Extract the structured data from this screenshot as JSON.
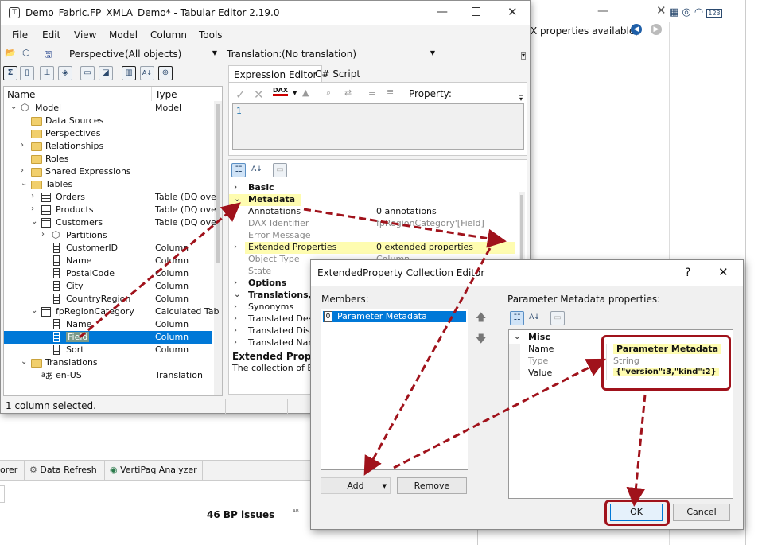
{
  "bg_window": {
    "partial_text": "X properties available)",
    "status_issues": "46 BP issues",
    "bottom_tabs": [
      "orer",
      "Data Refresh",
      "VertiPaq Analyzer"
    ]
  },
  "main": {
    "title": "Demo_Fabric.FP_XMLA_Demo* - Tabular Editor 2.19.0",
    "menu": [
      "File",
      "Edit",
      "View",
      "Model",
      "Column",
      "Tools"
    ],
    "perspective_label": "Perspective:",
    "perspective_value": "(All objects)",
    "translation_label": "Translation:",
    "translation_value": "(No translation)",
    "tree_headers": {
      "name": "Name",
      "type": "Type"
    },
    "tree": [
      {
        "label": "Model",
        "type": "Model"
      },
      {
        "label": "Data Sources",
        "type": ""
      },
      {
        "label": "Perspectives",
        "type": ""
      },
      {
        "label": "Relationships",
        "type": ""
      },
      {
        "label": "Roles",
        "type": ""
      },
      {
        "label": "Shared Expressions",
        "type": ""
      },
      {
        "label": "Tables",
        "type": ""
      },
      {
        "label": "Orders",
        "type": "Table (DQ ove"
      },
      {
        "label": "Products",
        "type": "Table (DQ ove"
      },
      {
        "label": "Customers",
        "type": "Table (DQ ove"
      },
      {
        "label": "Partitions",
        "type": ""
      },
      {
        "label": "CustomerID",
        "type": "Column"
      },
      {
        "label": "Name",
        "type": "Column"
      },
      {
        "label": "PostalCode",
        "type": "Column"
      },
      {
        "label": "City",
        "type": "Column"
      },
      {
        "label": "CountryRegion",
        "type": "Column"
      },
      {
        "label": "fpRegionCategory",
        "type": "Calculated Tab"
      },
      {
        "label": "Name",
        "type": "Column"
      },
      {
        "label": "Field",
        "type": "Column"
      },
      {
        "label": "Sort",
        "type": "Column"
      },
      {
        "label": "Translations",
        "type": ""
      },
      {
        "label": "en-US",
        "type": "Translation"
      }
    ],
    "status": "1 column selected.",
    "editor_tabs": [
      "Expression Editor",
      "C# Script"
    ],
    "property_label": "Property:",
    "line_number": "1",
    "props": {
      "basic": "Basic",
      "metadata": "Metadata",
      "annotations_k": "Annotations",
      "annotations_v": "0 annotations",
      "dax_k": "DAX Identifier",
      "dax_v": "fpRegionCategory'[Field]",
      "error_k": "Error Message",
      "ext_k": "Extended Properties",
      "ext_v": "0 extended properties",
      "objtype_k": "Object Type",
      "objtype_v": "Column",
      "state_k": "State",
      "options": "Options",
      "translations": "Translations,",
      "synonyms": "Synonyms",
      "trans_desc": "Translated Desc",
      "trans_disp": "Translated Disp",
      "trans_name": "Translated Nam",
      "desc_title": "Extended Proper",
      "desc_text": "The collection of Ex"
    }
  },
  "dialog": {
    "title": "ExtendedProperty Collection Editor",
    "help": "?",
    "members_label": "Members:",
    "member_index": "0",
    "member_name": "Parameter Metadata",
    "props_label": "Parameter Metadata properties:",
    "misc": "Misc",
    "name_k": "Name",
    "name_v": "Parameter Metadata",
    "type_k": "Type",
    "type_v": "String",
    "value_k": "Value",
    "value_v": "{\"version\":3,\"kind\":2}",
    "add": "Add",
    "remove": "Remove",
    "ok": "OK",
    "cancel": "Cancel"
  },
  "colors": {
    "highlight": "#fefcb0",
    "selection": "#0078d7",
    "arrow": "#a0121b"
  }
}
